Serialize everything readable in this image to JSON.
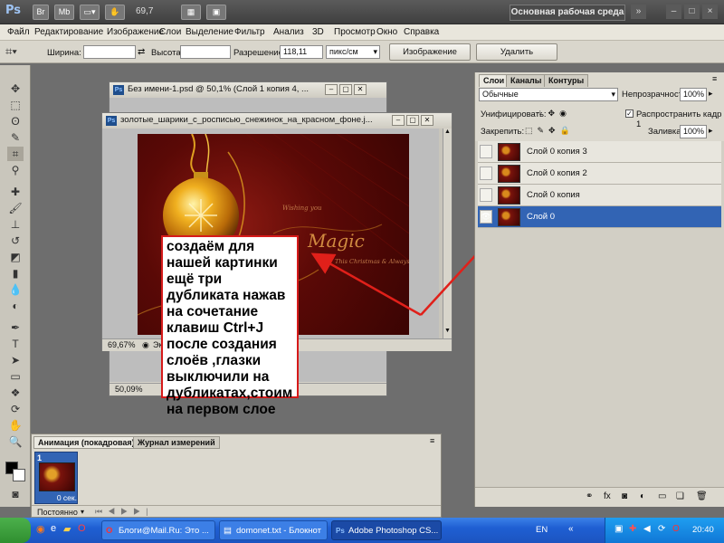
{
  "app": {
    "logo": "Ps",
    "title_buttons": [
      "Br",
      "Mb"
    ],
    "zoom": "69,7",
    "workspace": "Основная рабочая среда"
  },
  "window_controls": [
    "»",
    "–",
    "□",
    "×"
  ],
  "menu": [
    "Файл",
    "Редактирование",
    "Изображение",
    "Слои",
    "Выделение",
    "Фильтр",
    "Анализ",
    "3D",
    "Просмотр",
    "Окно",
    "Справка"
  ],
  "options": {
    "width_label": "Ширина:",
    "width_value": "",
    "height_label": "Высота:",
    "height_value": "",
    "resolution_label": "Разрешение:",
    "resolution_value": "118,11",
    "units": "пикс/см",
    "image_button": "Изображение",
    "delete_button": "Удалить"
  },
  "doc_back": {
    "title": "Без имени-1.psd @ 50,1% (Слой 1 копия 4, ...",
    "zoom": "50,09%"
  },
  "doc_front": {
    "title": "золотые_шарики_с_росписью_снежинок_на_красном_фоне.j...",
    "zoom": "69,67%",
    "status": "Эк"
  },
  "artwork_text": {
    "wishing": "Wishing you",
    "magic": "Magic",
    "christmas": "This Christmas & Always"
  },
  "annotation": {
    "text": "создаём для нашей картинки ещё три дубликата нажав на сочетание клавиш Ctrl+J  после создания слоёв ,глазки выключили на дубликатах,стоим на первом слое"
  },
  "layers_panel": {
    "tabs": [
      "Слои",
      "Каналы",
      "Контуры"
    ],
    "blend_mode": "Обычные",
    "opacity_label": "Непрозрачность:",
    "opacity_value": "100%",
    "unify_label": "Унифицировать:",
    "propagate_label": "Распространить кадр 1",
    "lock_label": "Закрепить:",
    "fill_label": "Заливка:",
    "fill_value": "100%",
    "layers": [
      {
        "name": "Слой 0 копия 3",
        "visible": false,
        "selected": false
      },
      {
        "name": "Слой 0 копия 2",
        "visible": false,
        "selected": false
      },
      {
        "name": "Слой 0 копия",
        "visible": false,
        "selected": false
      },
      {
        "name": "Слой 0",
        "visible": true,
        "selected": true
      }
    ]
  },
  "animation_panel": {
    "tabs": [
      "Анимация (покадровая)",
      "Журнал измерений"
    ],
    "frame_number": "1",
    "frame_delay": "0 сек.",
    "loop": "Постоянно"
  },
  "taskbar": {
    "tasks": [
      "Блоги@Mail.Ru: Это ...",
      "domonet.txt - Блокнот",
      "Adobe Photoshop CS..."
    ],
    "lang": "EN",
    "clock": "20:40"
  },
  "colors": {
    "selected_layer": "#3264b4",
    "annotation_border": "#d61a1a",
    "arrow": "#e0201a"
  }
}
